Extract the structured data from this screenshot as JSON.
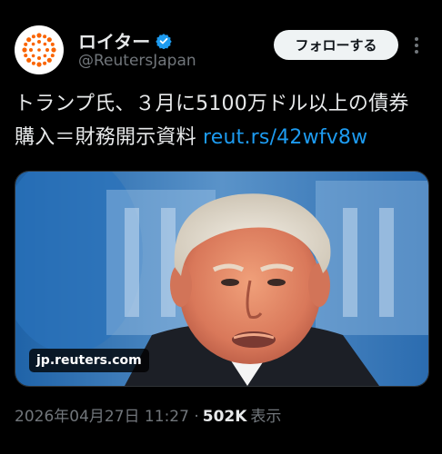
{
  "author": {
    "display_name": "ロイター",
    "handle": "@ReutersJapan",
    "verified_icon": "verified-badge-icon",
    "avatar_icon": "reuters-logo-icon"
  },
  "actions": {
    "follow_label": "フォローする",
    "more_icon": "more-vertical-icon"
  },
  "tweet": {
    "text": "トランプ氏、３月に5100万ドル以上の債券購入＝財務開示資料 ",
    "link": "reut.rs/42wfv8w"
  },
  "media": {
    "domain": "jp.reuters.com"
  },
  "meta": {
    "timestamp": "2026年04月27日 11:27 · ",
    "views_count": "502K",
    "views_label": "表示"
  },
  "colors": {
    "background": "#000000",
    "text": "#e7e9ea",
    "muted": "#71767b",
    "link": "#1d9bf0"
  }
}
